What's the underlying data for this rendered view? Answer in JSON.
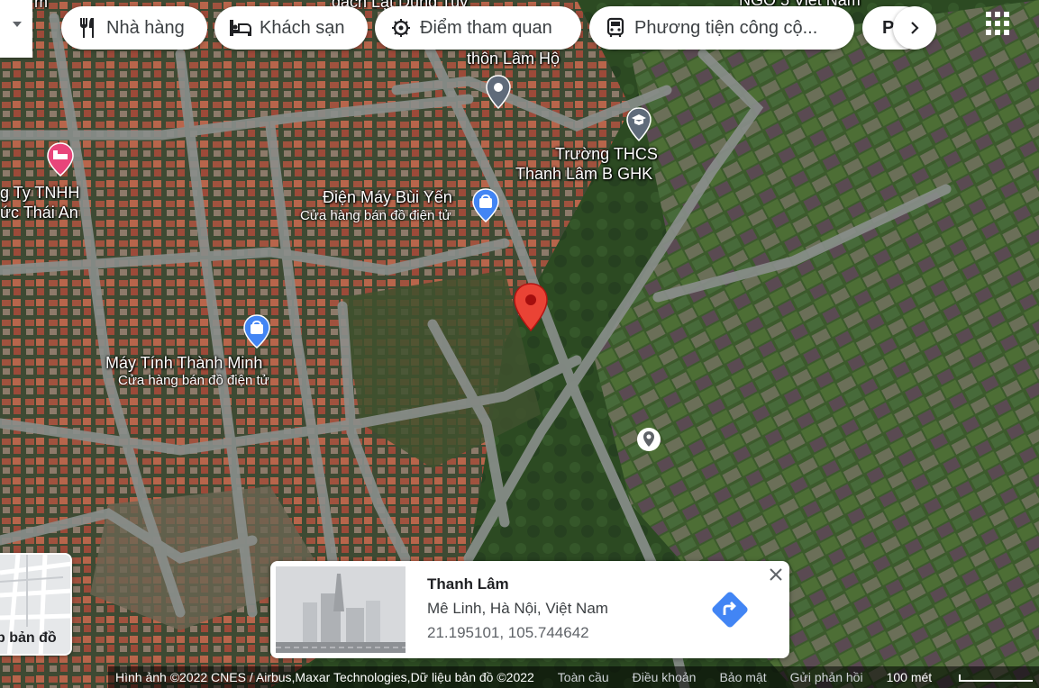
{
  "categories": [
    {
      "label": "Nhà hàng",
      "icon": "restaurant-icon"
    },
    {
      "label": "Khách sạn",
      "icon": "hotel-icon"
    },
    {
      "label": "Điểm tham quan",
      "icon": "attraction-icon"
    },
    {
      "label": "Phương tiện công cộ...",
      "icon": "transit-icon"
    },
    {
      "label": "P",
      "icon": "parking-icon"
    }
  ],
  "map_labels": {
    "top_partial": "đạch Lật Dung Tuy",
    "top_right_partial": "NGO 5 Việt Nam",
    "left_top_partial": "m",
    "lam_ho": "thôn Lâm Hộ",
    "school_line1": "Trường THCS",
    "school_line2": "Thanh Lâm B GHK",
    "store1_name": "Điện Máy Bùi Yến",
    "store1_type": "Cửa hàng bán đồ điện tử",
    "company_line1": "g Ty TNHH",
    "company_line2": "ức Thái An",
    "store2_name": "Máy Tính Thành Minh",
    "store2_type": "Cửa hàng bán đồ điện tử"
  },
  "layer_toggle": {
    "label": "p bản đồ"
  },
  "place_card": {
    "name": "Thanh Lâm",
    "address": "Mê Linh, Hà Nội, Việt Nam",
    "coordinates": "21.195101, 105.744642",
    "close_icon": "close-icon",
    "directions_icon": "directions-icon"
  },
  "footer": {
    "attribution": "Hình ảnh ©2022 CNES / Airbus,Maxar Technologies,Dữ liệu bản đồ ©2022",
    "terms1": "Toàn cầu",
    "terms2": "Điều khoản",
    "privacy": "Bảo mật",
    "feedback": "Gửi phản hồi",
    "scale": "100 mét"
  },
  "colors": {
    "pin_red": "#ea4335",
    "store_blue": "#4285f4",
    "hotel_pink": "#e8457a",
    "poi_gray": "#5f6b7a"
  }
}
